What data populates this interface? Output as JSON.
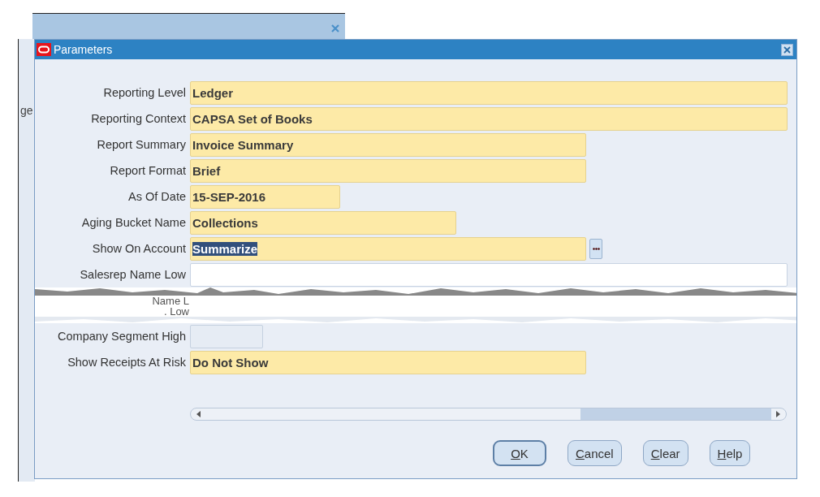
{
  "background_window": {
    "fragment": "ge"
  },
  "window": {
    "title": "Parameters"
  },
  "fields": [
    {
      "kind": "field",
      "label": "Reporting Level",
      "value": "Ledger",
      "required": true,
      "disabled": false,
      "selected": false
    },
    {
      "kind": "field",
      "label": "Reporting Context",
      "value": "CAPSA Set of Books",
      "required": true,
      "disabled": false,
      "selected": false
    },
    {
      "kind": "field",
      "label": "Report Summary",
      "value": "Invoice Summary",
      "required": true,
      "disabled": false,
      "selected": false
    },
    {
      "kind": "field",
      "label": "Report Format",
      "value": "Brief",
      "required": true,
      "disabled": false,
      "selected": false
    },
    {
      "kind": "field",
      "label": "As Of Date",
      "value": "15-SEP-2016",
      "required": true,
      "disabled": false,
      "selected": false
    },
    {
      "kind": "field",
      "label": "Aging Bucket Name",
      "value": "Collections",
      "required": true,
      "disabled": false,
      "selected": false
    },
    {
      "kind": "field",
      "label": "Show On Account",
      "value": "Summarize",
      "required": true,
      "disabled": false,
      "selected": true,
      "lov": true
    },
    {
      "kind": "field",
      "label": "Salesrep Name Low",
      "required": false,
      "disabled": false
    },
    {
      "kind": "torn",
      "label": "Name L"
    },
    {
      "kind": "torn",
      "label": ". Low"
    },
    {
      "kind": "field",
      "label": "Company Segment High",
      "required": false,
      "disabled": true
    },
    {
      "kind": "field",
      "label": "Show Receipts At Risk",
      "value": "Do Not Show",
      "required": true,
      "disabled": false,
      "selected": false
    }
  ],
  "buttons": [
    {
      "label": "OK",
      "default": true
    },
    {
      "label": "Cancel",
      "default": false
    },
    {
      "label": "Clear",
      "default": false
    },
    {
      "label": "Help",
      "default": false
    }
  ]
}
